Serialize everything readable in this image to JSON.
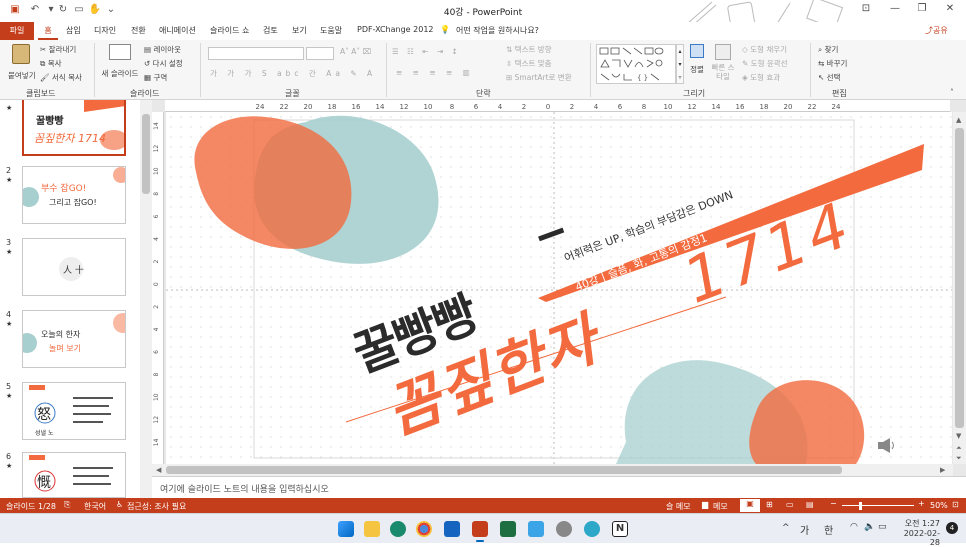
{
  "window": {
    "title": "40강  -  PowerPoint"
  },
  "ribbon_tabs": [
    "파일",
    "홈",
    "삽입",
    "디자인",
    "전환",
    "애니메이션",
    "슬라이드 쇼",
    "검토",
    "보기",
    "도움말",
    "PDF-XChange 2012"
  ],
  "tell_me": "어떤 작업을 원하시나요?",
  "share": "공유",
  "clipboard": {
    "paste": "붙여넣기",
    "cut": "잘라내기",
    "copy": "복사",
    "format_painter": "서식 복사",
    "group": "클립보드"
  },
  "slides_group": {
    "new_slide": "새 슬라이드",
    "layout": "레이아웃",
    "reset": "다시 설정",
    "section": "구역",
    "group": "슬라이드"
  },
  "font_group": {
    "group": "글꼴",
    "bold": "가",
    "italic": "가",
    "underline": "가",
    "shadow": "S",
    "strike": "abc",
    "spacing": "간",
    "case": "Aa"
  },
  "paragraph_group": {
    "group": "단락",
    "text_direction": "텍스트 방향",
    "align_text": "텍스트 맞춤",
    "smartart": "SmartArt로 변환"
  },
  "drawing_group": {
    "group": "그리기",
    "arrange": "정렬",
    "quick_styles": "빠른 스타일",
    "fill": "도형 채우기",
    "outline": "도형 윤곽선",
    "effects": "도형 효과"
  },
  "editing_group": {
    "group": "편집",
    "find": "찾기",
    "replace": "바꾸기",
    "select": "선택"
  },
  "thumbnails": [
    {
      "num": "1",
      "star": "★",
      "t1": "꿀빵빵",
      "t2": "꼼짚한자 1714"
    },
    {
      "num": "2",
      "star": "★",
      "t1": "부수 잡GO!",
      "t2": "그리고 잡GO!"
    },
    {
      "num": "3",
      "star": "★",
      "t1": "人 十",
      "t2": ""
    },
    {
      "num": "4",
      "star": "★",
      "t1": "오늘의 한자",
      "t2": "놀며 보기"
    },
    {
      "num": "5",
      "star": "★",
      "t1": "怒",
      "t2": "성낼 노"
    },
    {
      "num": "6",
      "star": "★",
      "t1": "慨",
      "t2": ""
    }
  ],
  "ruler_h": [
    "24",
    "22",
    "20",
    "18",
    "16",
    "14",
    "12",
    "10",
    "8",
    "6",
    "4",
    "2",
    "0",
    "2",
    "4",
    "6",
    "8",
    "10",
    "12",
    "14",
    "16",
    "18",
    "20",
    "22",
    "24"
  ],
  "ruler_v": [
    "14",
    "12",
    "10",
    "8",
    "6",
    "4",
    "2",
    "0",
    "2",
    "4",
    "6",
    "8",
    "10",
    "12",
    "14"
  ],
  "slide": {
    "brand": "꿀빵빵",
    "subtitle": "어휘력은 UP, 학습의 부담감은  DOWN",
    "ribbon_text": "40강 | 슬픔, 화, 고통의 감정1",
    "big_title": "꼼짚한자",
    "big_number": "1714",
    "colors": {
      "orange": "#f26a3d",
      "coral": "#f58a66",
      "teal": "#a7cfcf",
      "dark": "#2b2b2b"
    }
  },
  "notes_placeholder": "여기에 슬라이드 노트의 내용을 입력하십시오",
  "status": {
    "slide": "슬라이드 1/28",
    "lang": "한국어",
    "accessibility": "접근성: 조사 필요",
    "notes": "슬 메모",
    "comments": "메모",
    "zoom": "50%"
  },
  "taskbar": {
    "ime1": "가",
    "ime2": "한",
    "time": "오전 1:27",
    "date": "2022-02-28",
    "badge": "4"
  }
}
